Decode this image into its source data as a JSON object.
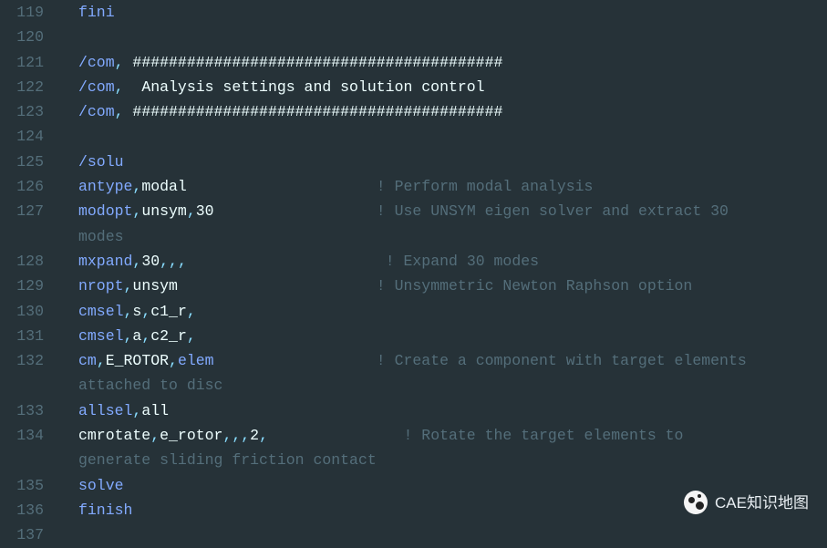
{
  "watermark": "CAE知识地图",
  "lines": [
    {
      "num": "119",
      "segs": [
        {
          "t": "fini",
          "c": "tok-kw"
        }
      ]
    },
    {
      "num": "120",
      "segs": [
        {
          "t": "",
          "c": "tok-plain"
        }
      ]
    },
    {
      "num": "121",
      "segs": [
        {
          "t": "/com",
          "c": "tok-kw"
        },
        {
          "t": ",",
          "c": "tok-punct"
        },
        {
          "t": " #########################################",
          "c": "tok-white"
        }
      ]
    },
    {
      "num": "122",
      "segs": [
        {
          "t": "/com",
          "c": "tok-kw"
        },
        {
          "t": ",",
          "c": "tok-punct"
        },
        {
          "t": "  Analysis settings and solution control",
          "c": "tok-white"
        }
      ]
    },
    {
      "num": "123",
      "segs": [
        {
          "t": "/com",
          "c": "tok-kw"
        },
        {
          "t": ",",
          "c": "tok-punct"
        },
        {
          "t": " #########################################",
          "c": "tok-white"
        }
      ]
    },
    {
      "num": "124",
      "segs": [
        {
          "t": "",
          "c": "tok-plain"
        }
      ]
    },
    {
      "num": "125",
      "segs": [
        {
          "t": "/solu",
          "c": "tok-kw"
        }
      ]
    },
    {
      "num": "126",
      "segs": [
        {
          "t": "antype",
          "c": "tok-kw"
        },
        {
          "t": ",",
          "c": "tok-punct"
        },
        {
          "t": "modal",
          "c": "tok-white"
        },
        {
          "t": "                     ",
          "c": "tok-plain"
        },
        {
          "t": "! Perform modal analysis",
          "c": "tok-comment"
        }
      ]
    },
    {
      "num": "127",
      "segs": [
        {
          "t": "modopt",
          "c": "tok-kw"
        },
        {
          "t": ",",
          "c": "tok-punct"
        },
        {
          "t": "unsym",
          "c": "tok-white"
        },
        {
          "t": ",",
          "c": "tok-punct"
        },
        {
          "t": "30",
          "c": "tok-white"
        },
        {
          "t": "                  ",
          "c": "tok-plain"
        },
        {
          "t": "! Use UNSYM eigen solver and extract 30 ",
          "c": "tok-comment"
        }
      ]
    },
    {
      "num": "",
      "segs": [
        {
          "t": "modes",
          "c": "tok-comment"
        }
      ]
    },
    {
      "num": "128",
      "segs": [
        {
          "t": "mxpand",
          "c": "tok-kw"
        },
        {
          "t": ",",
          "c": "tok-punct"
        },
        {
          "t": "30",
          "c": "tok-white"
        },
        {
          "t": ",,,",
          "c": "tok-punct"
        },
        {
          "t": "                      ",
          "c": "tok-plain"
        },
        {
          "t": "! Expand 30 modes",
          "c": "tok-comment"
        }
      ]
    },
    {
      "num": "129",
      "segs": [
        {
          "t": "nropt",
          "c": "tok-kw"
        },
        {
          "t": ",",
          "c": "tok-punct"
        },
        {
          "t": "unsym",
          "c": "tok-white"
        },
        {
          "t": "                      ",
          "c": "tok-plain"
        },
        {
          "t": "! Unsymmetric Newton Raphson option",
          "c": "tok-comment"
        }
      ]
    },
    {
      "num": "130",
      "segs": [
        {
          "t": "cmsel",
          "c": "tok-kw"
        },
        {
          "t": ",",
          "c": "tok-punct"
        },
        {
          "t": "s",
          "c": "tok-white"
        },
        {
          "t": ",",
          "c": "tok-punct"
        },
        {
          "t": "c1_r",
          "c": "tok-white"
        },
        {
          "t": ",",
          "c": "tok-punct"
        }
      ]
    },
    {
      "num": "131",
      "segs": [
        {
          "t": "cmsel",
          "c": "tok-kw"
        },
        {
          "t": ",",
          "c": "tok-punct"
        },
        {
          "t": "a",
          "c": "tok-white"
        },
        {
          "t": ",",
          "c": "tok-punct"
        },
        {
          "t": "c2_r",
          "c": "tok-white"
        },
        {
          "t": ",",
          "c": "tok-punct"
        }
      ]
    },
    {
      "num": "132",
      "segs": [
        {
          "t": "cm",
          "c": "tok-kw"
        },
        {
          "t": ",",
          "c": "tok-punct"
        },
        {
          "t": "E_ROTOR",
          "c": "tok-white"
        },
        {
          "t": ",",
          "c": "tok-punct"
        },
        {
          "t": "elem",
          "c": "tok-kw"
        },
        {
          "t": "                  ",
          "c": "tok-plain"
        },
        {
          "t": "! Create a component with target elements ",
          "c": "tok-comment"
        }
      ]
    },
    {
      "num": "",
      "segs": [
        {
          "t": "attached to disc",
          "c": "tok-comment"
        }
      ]
    },
    {
      "num": "133",
      "segs": [
        {
          "t": "allsel",
          "c": "tok-kw"
        },
        {
          "t": ",",
          "c": "tok-punct"
        },
        {
          "t": "all",
          "c": "tok-white"
        }
      ]
    },
    {
      "num": "134",
      "segs": [
        {
          "t": "cmrotate",
          "c": "tok-white"
        },
        {
          "t": ",",
          "c": "tok-punct"
        },
        {
          "t": "e_rotor",
          "c": "tok-white"
        },
        {
          "t": ",,,",
          "c": "tok-punct"
        },
        {
          "t": "2",
          "c": "tok-white"
        },
        {
          "t": ",",
          "c": "tok-punct"
        },
        {
          "t": "               ",
          "c": "tok-plain"
        },
        {
          "t": "! Rotate the target elements to ",
          "c": "tok-comment"
        }
      ]
    },
    {
      "num": "",
      "segs": [
        {
          "t": "generate sliding friction contact",
          "c": "tok-comment"
        }
      ]
    },
    {
      "num": "135",
      "segs": [
        {
          "t": "solve",
          "c": "tok-kw"
        }
      ]
    },
    {
      "num": "136",
      "segs": [
        {
          "t": "finish",
          "c": "tok-kw"
        }
      ]
    },
    {
      "num": "137",
      "segs": [
        {
          "t": "",
          "c": "tok-plain"
        }
      ]
    }
  ]
}
